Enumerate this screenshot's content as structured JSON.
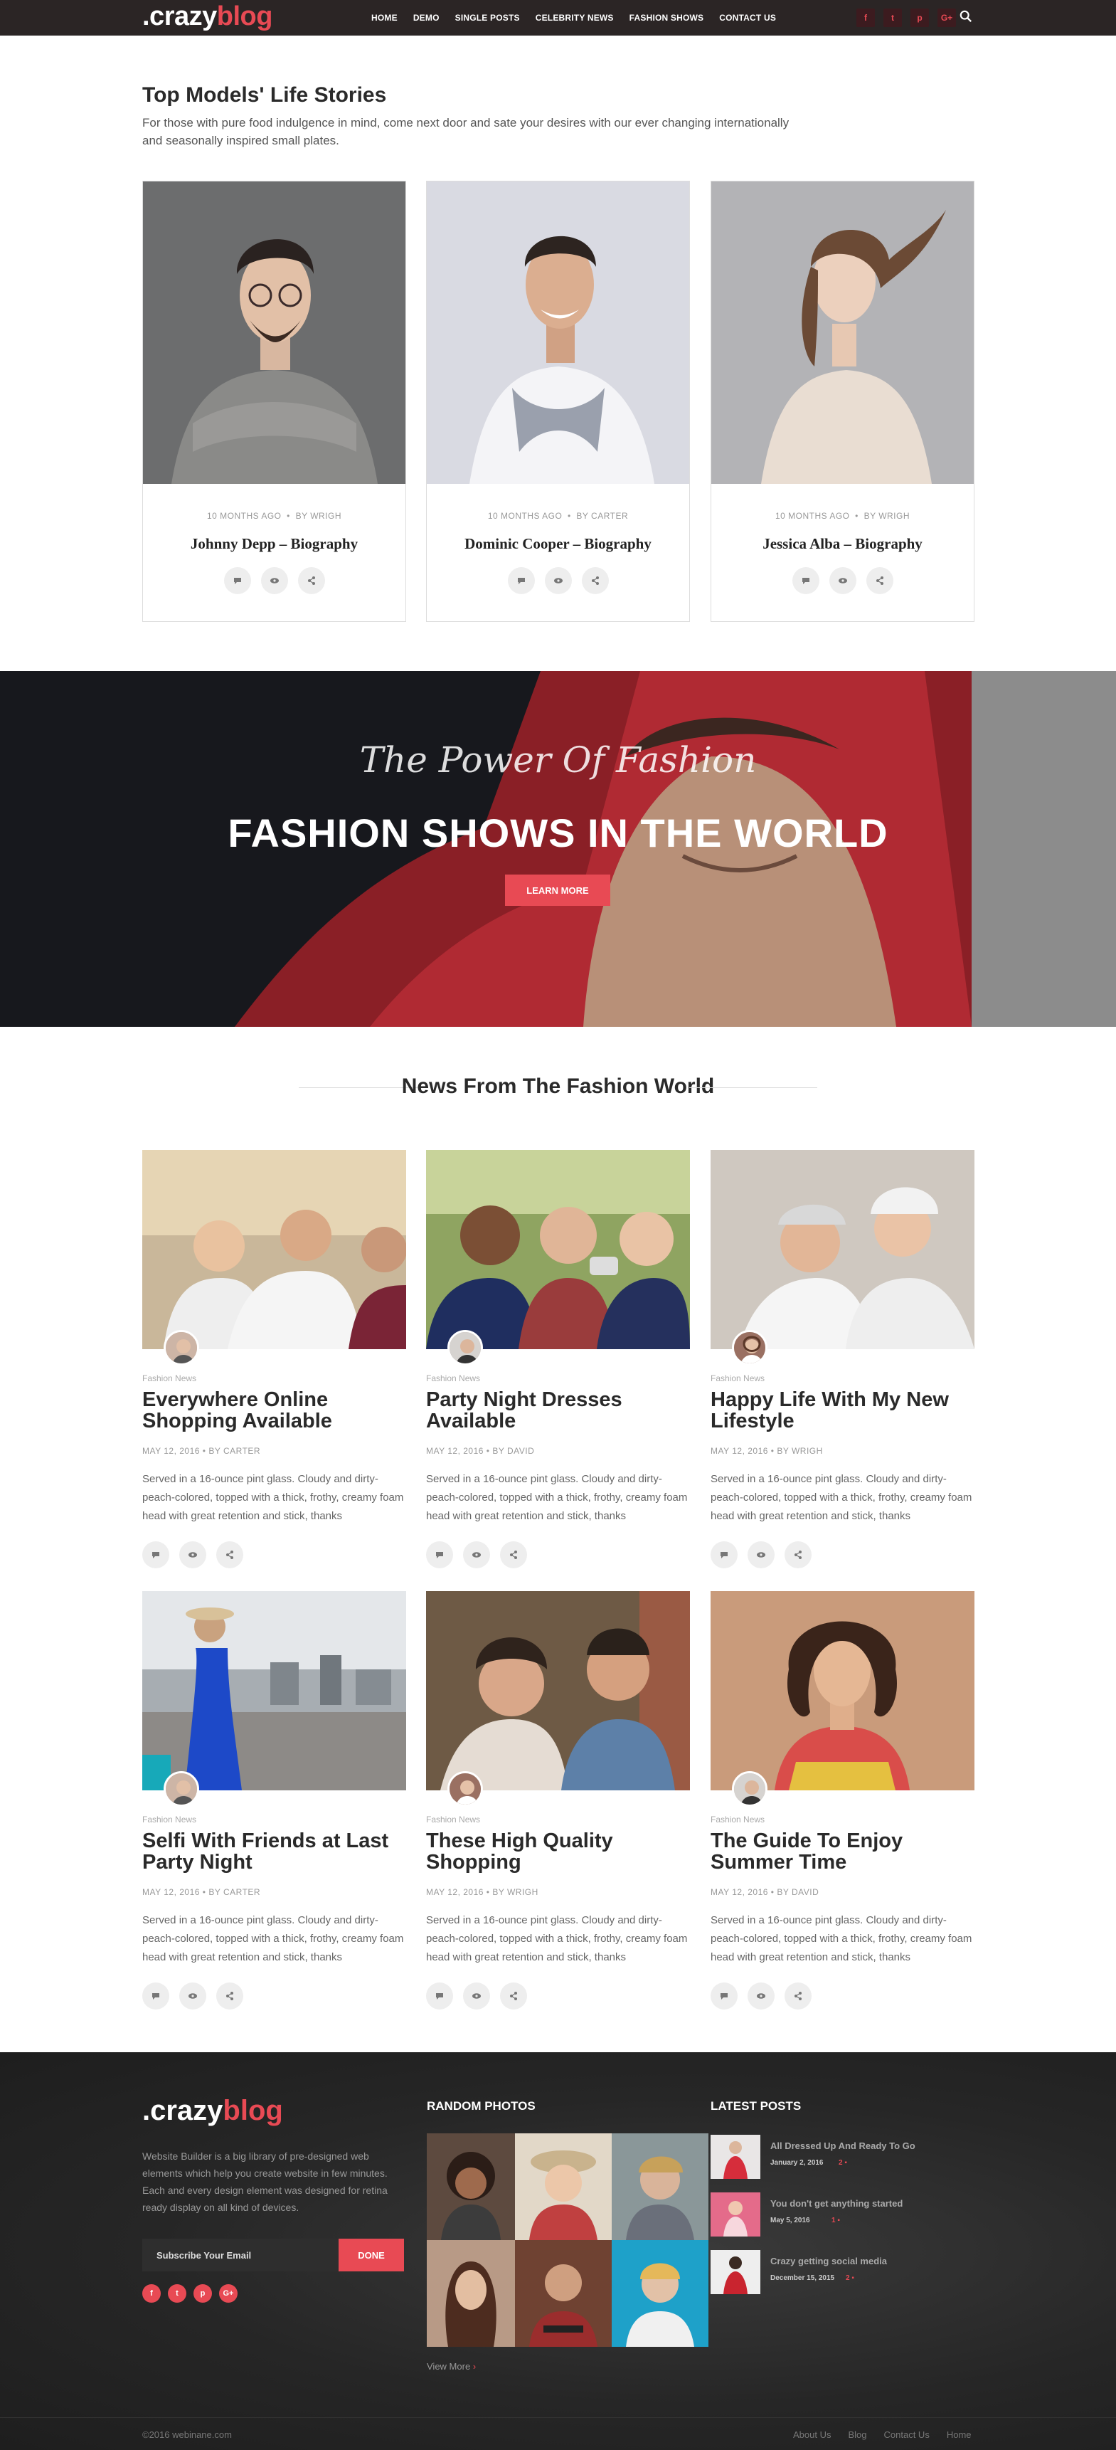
{
  "nav": {
    "logo_prefix": ".crazy",
    "logo_accent": "blog",
    "menu": [
      "HOME",
      "DEMO",
      "SINGLE POSTS",
      "CELEBRITY NEWS",
      "FASHION SHOWS",
      "CONTACT US"
    ],
    "social": [
      "f",
      "t",
      "p",
      "G+"
    ]
  },
  "models": {
    "title": "Top Models' Life Stories",
    "description": "For those with pure food indulgence in mind, come next door and sate your desires with our ever changing internationally and seasonally inspired small plates.",
    "cards": [
      {
        "time": "10 MONTHS AGO",
        "author": "BY WRIGH",
        "name": "Johnny Depp – Biography"
      },
      {
        "time": "10 MONTHS AGO",
        "author": "BY CARTER",
        "name": "Dominic Cooper – Biography"
      },
      {
        "time": "10 MONTHS AGO",
        "author": "BY WRIGH",
        "name": "Jessica Alba – Biography"
      }
    ]
  },
  "banner": {
    "script": "The Power Of Fashion",
    "title": "FASHION SHOWS IN THE WORLD",
    "button": "LEARN MORE"
  },
  "news": {
    "title": "News From The Fashion World",
    "posts": [
      {
        "category": "Fashion News",
        "title": "Everywhere Online Shopping Available",
        "date": "MAY 12, 2016",
        "author": "BY CARTER",
        "desc": "Served in a 16-ounce pint glass. Cloudy and dirty-peach-colored, topped with a thick, frothy, creamy foam head with great retention and stick, thanks"
      },
      {
        "category": "Fashion News",
        "title": "Party Night Dresses Available",
        "date": "MAY 12, 2016",
        "author": "BY DAVID",
        "desc": "Served in a 16-ounce pint glass. Cloudy and dirty-peach-colored, topped with a thick, frothy, creamy foam head with great retention and stick, thanks"
      },
      {
        "category": "Fashion News",
        "title": "Happy Life With My New Lifestyle",
        "date": "MAY 12, 2016",
        "author": "BY WRIGH",
        "desc": "Served in a 16-ounce pint glass. Cloudy and dirty-peach-colored, topped with a thick, frothy, creamy foam head with great retention and stick, thanks"
      },
      {
        "category": "Fashion News",
        "title": "Selfi With Friends at Last Party Night",
        "date": "MAY 12, 2016",
        "author": "BY CARTER",
        "desc": "Served in a 16-ounce pint glass. Cloudy and dirty-peach-colored, topped with a thick, frothy, creamy foam head with great retention and stick, thanks"
      },
      {
        "category": "Fashion News",
        "title": "These High Quality Shopping",
        "date": "MAY 12, 2016",
        "author": "BY WRIGH",
        "desc": "Served in a 16-ounce pint glass. Cloudy and dirty-peach-colored, topped with a thick, frothy, creamy foam head with great retention and stick, thanks"
      },
      {
        "category": "Fashion News",
        "title": "The Guide To Enjoy Summer Time",
        "date": "MAY 12, 2016",
        "author": "BY DAVID",
        "desc": "Served in a 16-ounce pint glass. Cloudy and dirty-peach-colored, topped with a thick, frothy, creamy foam head with great retention and stick, thanks"
      }
    ]
  },
  "footer": {
    "logo_prefix": ".crazy",
    "logo_accent": "blog",
    "description": "Website Builder is a big library of pre-designed web elements which help you create website in few minutes. Each and every design element was designed for retina ready display on all kind of devices.",
    "subscribe_placeholder": "Subscribe Your Email",
    "done": "DONE",
    "social": [
      "f",
      "t",
      "p",
      "G+"
    ],
    "photos_heading": "RANDOM PHOTOS",
    "view_more": "View More",
    "view_more_arrow": "›",
    "latest_heading": "LATEST POSTS",
    "latest": [
      {
        "title": "All Dressed Up And Ready To Go",
        "date": "January 2, 2016",
        "count": "2"
      },
      {
        "title": "You don't get anything started",
        "date": "May 5, 2016",
        "count": "1"
      },
      {
        "title": "Crazy getting social media",
        "date": "December 15, 2015",
        "count": "2"
      }
    ],
    "copyright": "©2016 webinane.com",
    "links": [
      "About Us",
      "Blog",
      "Contact Us",
      "Home"
    ]
  },
  "colors": {
    "accent": "#e84a54",
    "nav_bg": "#2b2525",
    "footer_bg": "#222222"
  }
}
